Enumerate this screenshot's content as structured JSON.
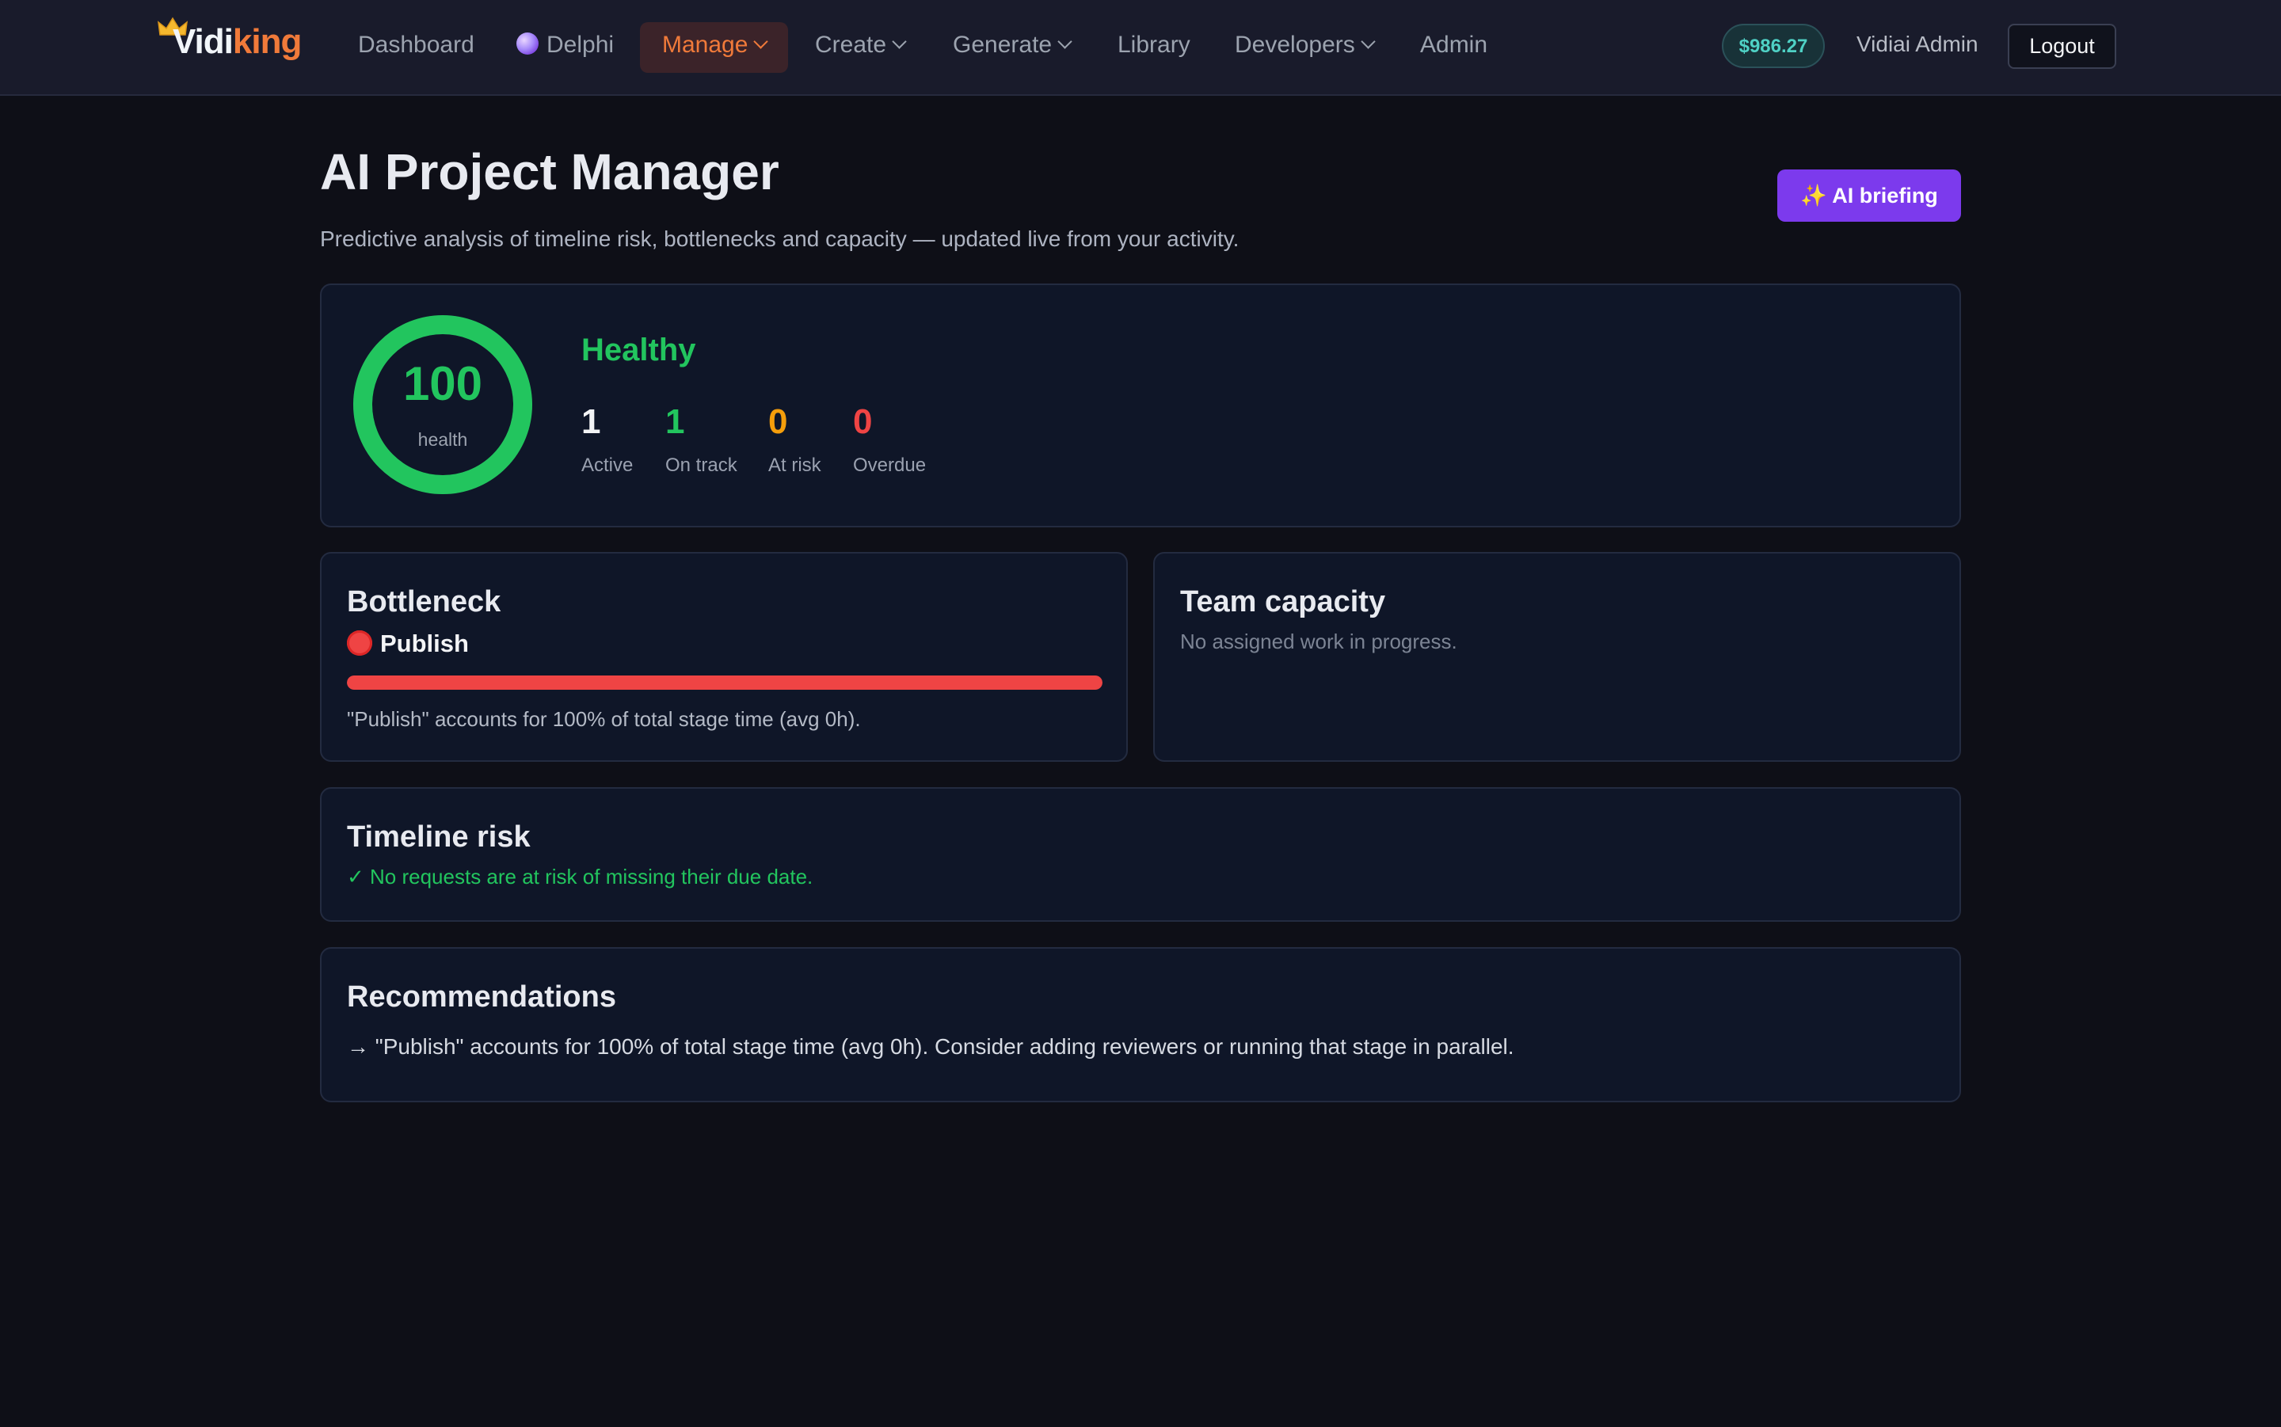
{
  "nav": {
    "logo_part1": "Vidi",
    "logo_part2": "king",
    "items": [
      {
        "label": "Dashboard"
      },
      {
        "label": "Delphi"
      },
      {
        "label": "Manage"
      },
      {
        "label": "Create"
      },
      {
        "label": "Generate"
      },
      {
        "label": "Library"
      },
      {
        "label": "Developers"
      },
      {
        "label": "Admin"
      }
    ],
    "balance": "$986.27",
    "user": "Vidiai Admin",
    "logout": "Logout"
  },
  "header": {
    "title": "AI Project Manager",
    "subtitle": "Predictive analysis of timeline risk, bottlenecks and capacity — updated live from your activity.",
    "ai_button": "✨ AI briefing"
  },
  "health": {
    "score": "100",
    "score_label": "health",
    "score_fraction": 1.0,
    "status": "Healthy",
    "stats": [
      {
        "value": "1",
        "label": "Active",
        "color": "#f3f4f6"
      },
      {
        "value": "1",
        "label": "On track",
        "color": "#22c55e"
      },
      {
        "value": "0",
        "label": "At risk",
        "color": "#f59e0b"
      },
      {
        "value": "0",
        "label": "Overdue",
        "color": "#ef4444"
      }
    ]
  },
  "bottleneck": {
    "title": "Bottleneck",
    "stage": "Publish",
    "share_percent": 100,
    "description": "\"Publish\" accounts for 100% of total stage time (avg 0h)."
  },
  "capacity": {
    "title": "Team capacity",
    "message": "No assigned work in progress."
  },
  "timeline": {
    "title": "Timeline risk",
    "message": "✓ No requests are at risk of missing their due date."
  },
  "recommendations": {
    "title": "Recommendations",
    "items": [
      {
        "text": "→ \"Publish\" accounts for 100% of total stage time (avg 0h). Consider adding reviewers or running that stage in parallel."
      }
    ]
  },
  "colors": {
    "brand": "#f07a3a",
    "accent": "#7c3aed",
    "success": "#22c55e",
    "warning": "#f59e0b",
    "danger": "#ef4444"
  }
}
